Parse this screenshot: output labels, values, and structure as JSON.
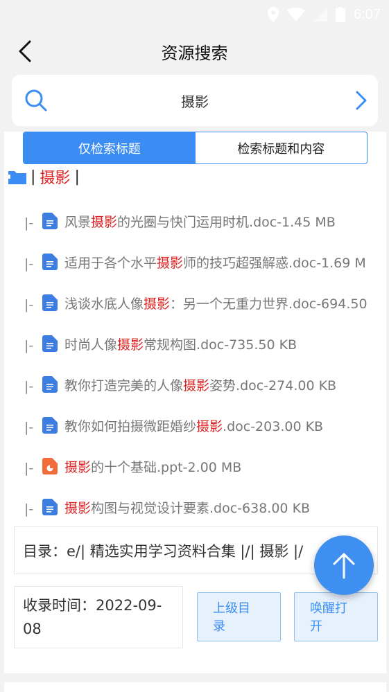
{
  "status_bar": {
    "time": "6:07"
  },
  "header": {
    "title": "资源搜索"
  },
  "search": {
    "query": "摄影"
  },
  "search_mode": {
    "options": [
      "仅检索标题",
      "检索标题和内容"
    ],
    "selected": "仅检索标题"
  },
  "folder": {
    "name": "摄影",
    "sep_left": "|",
    "sep_right": "|"
  },
  "files": [
    {
      "prefix": "|-",
      "type": "doc",
      "before": "风景",
      "hl": "摄影",
      "after": "的光圈与快门运用时机.doc-1.45 MB"
    },
    {
      "prefix": "|-",
      "type": "doc",
      "before": "适用于各个水平",
      "hl": "摄影",
      "after": "师的技巧超强解惑.doc-1.69 M"
    },
    {
      "prefix": "|-",
      "type": "doc",
      "before": "浅谈水底人像",
      "hl": "摄影",
      "after": "：另一个无重力世界.doc-694.50"
    },
    {
      "prefix": "|-",
      "type": "doc",
      "before": "时尚人像",
      "hl": "摄影",
      "after": "常规构图.doc-735.50 KB"
    },
    {
      "prefix": "|-",
      "type": "doc",
      "before": "教你打造完美的人像",
      "hl": "摄影",
      "after": "姿势.doc-274.00 KB"
    },
    {
      "prefix": "|-",
      "type": "doc",
      "before": "教你如何拍摄微距婚纱",
      "hl": "摄影",
      "after": ".doc-203.00 KB"
    },
    {
      "prefix": "|-",
      "type": "ppt",
      "before": "",
      "hl": "摄影",
      "after": "的十个基础.ppt-2.00 MB"
    },
    {
      "prefix": "|-",
      "type": "doc",
      "before": "",
      "hl": "摄影",
      "after": "构图与视觉设计要素.doc-638.00 KB"
    }
  ],
  "directory": {
    "text": "目录：e/| 精选实用学习资料合集 |/| 摄影 |/"
  },
  "record": {
    "line1": "收录时间：2022-09-",
    "line2": "08"
  },
  "buttons": {
    "up": {
      "line1": "上级目",
      "line2": "录"
    },
    "wake": {
      "line1": "唤醒打",
      "line2": "开"
    }
  },
  "colors": {
    "accent": "#3b8df3",
    "highlight": "#dd2222",
    "doc_icon": "#3b7de0",
    "ppt_icon": "#f26b3a"
  }
}
